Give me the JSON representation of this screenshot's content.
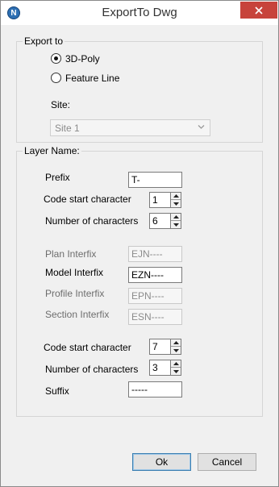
{
  "window": {
    "title": "ExportTo Dwg",
    "app_icon_letter": "N"
  },
  "export_to": {
    "group_title": "Export to",
    "options": [
      {
        "label": "3D-Poly",
        "checked": true
      },
      {
        "label": "Feature Line",
        "checked": false
      }
    ],
    "site_label": "Site:",
    "site_value": "Site 1"
  },
  "layer_name": {
    "group_title": "Layer Name:",
    "prefix_label": "Prefix",
    "prefix_value": "T-",
    "code_start_label_1": "Code start character",
    "code_start_value_1": "1",
    "num_chars_label_1": "Number of characters",
    "num_chars_value_1": "6",
    "plan_label": "Plan Interfix",
    "plan_value": "EJN----",
    "model_label": "Model Interfix",
    "model_value": "EZN----",
    "profile_label": "Profile Interfix",
    "profile_value": "EPN----",
    "section_label": "Section Interfix",
    "section_value": "ESN----",
    "code_start_label_2": "Code start character",
    "code_start_value_2": "7",
    "num_chars_label_2": "Number of characters",
    "num_chars_value_2": "3",
    "suffix_label": "Suffix",
    "suffix_value": "-----"
  },
  "buttons": {
    "ok": "Ok",
    "cancel": "Cancel"
  }
}
